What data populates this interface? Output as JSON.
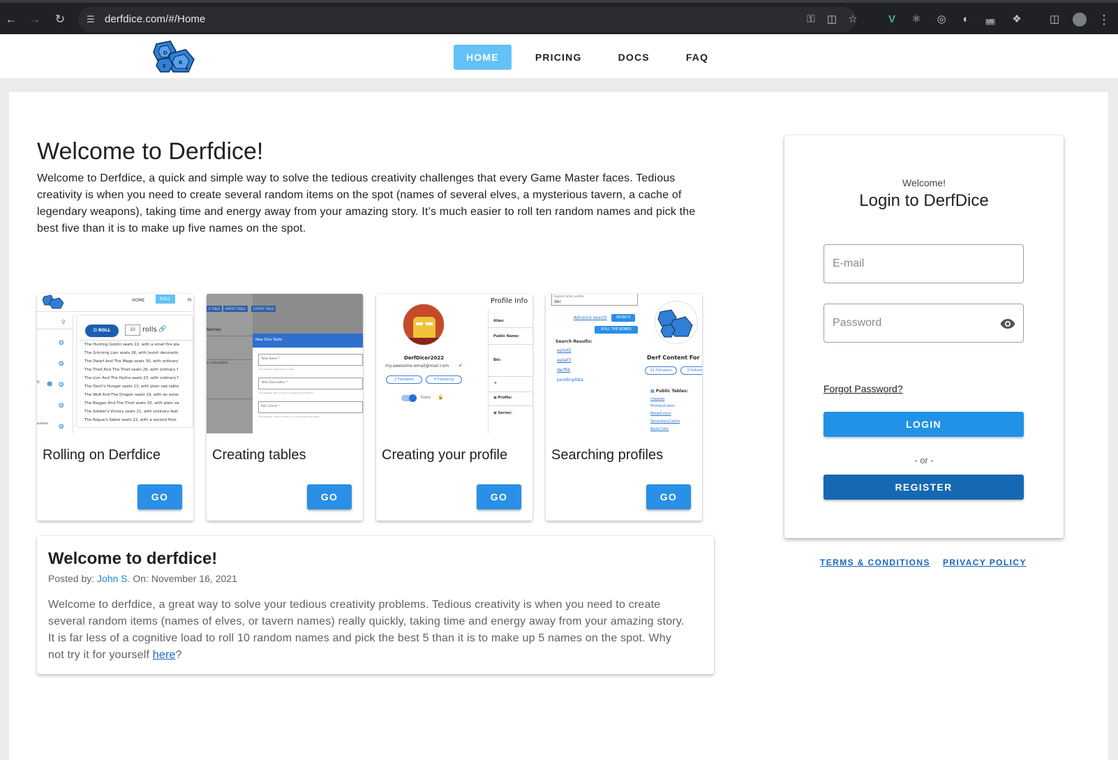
{
  "browser": {
    "url": "derfdice.com/#/Home",
    "ext_badge": "US"
  },
  "nav": {
    "items": [
      {
        "label": "HOME",
        "active": true
      },
      {
        "label": "PRICING"
      },
      {
        "label": "DOCS"
      },
      {
        "label": "FAQ"
      }
    ]
  },
  "intro": {
    "title": "Welcome to Derfdice!",
    "text": "Welcome to Derfdice, a quick and simple way to solve the tedious creativity challenges that every Game Master faces. Tedious creativity is when you need to create several random items on the spot (names of several elves, a mysterious tavern, a cache of legendary weapons), taking time and energy away from your amazing story. It’s much easier to roll ten random names and pick the best five than it is to make up five names on the spot."
  },
  "tiles": [
    {
      "title": "Rolling on Derfdice",
      "button": "GO"
    },
    {
      "title": "Creating tables",
      "button": "GO"
    },
    {
      "title": "Creating your profile",
      "button": "GO"
    },
    {
      "title": "Searching profiles",
      "button": "GO"
    }
  ],
  "tile_previews": {
    "rolling": {
      "nav": [
        "HOME",
        "ROLL",
        "PI"
      ],
      "roll_btn": "ROLL",
      "roll_count": "10",
      "rolls_label": "rolls",
      "results": [
        "The Hunting Goblin seats 22, with a small fire pla",
        "The Grinning Lion seats 26, with lavish decoratio",
        "The Dwarf And The Mage seats 30, with ordinary",
        "The Thief And The Thief seats 26, with ordinary f",
        "The Lion And The Hydra seats 23, with ordinary f",
        "The Devil's Hunger seats 13, with plain oak table",
        "The Wolf And The Dragon seats 19, with an exter",
        "The Beggar And The Thief seats 32, with plain oa",
        "The Soldier's Victory seats 21, with ordinary feat",
        "The Rogue's Sabre seats 22, with a second floor"
      ],
      "side_label": "ourdans"
    },
    "tables": {
      "tabs": [
        "E TABLE",
        "IMPORT TABLE",
        "EXPORT TABLE"
      ],
      "names_label": "Names",
      "dialog_title": "New Dice Table",
      "fields": [
        "Table Name *",
        "Table Description *",
        "Roll Criteria *"
      ],
      "hints": [
        "For example, professions or skills",
        "For example: This is a list of professions for D&D 5e",
        "For example: a 1d6 or 1d10 a. You can always edit it later."
      ],
      "left_hint": "is a description"
    },
    "profile": {
      "heading": "Profile Info",
      "username": "DerfDicer2022",
      "email": "my.awesome.email@mail.com",
      "followers": "2 Followers",
      "following": "4 Following",
      "public_label": "Public",
      "fields": [
        "Alias:",
        "Public Name:",
        "Bio:",
        "Profile:",
        "Server:"
      ]
    },
    "search": {
      "explore_label": "Explore other profiles",
      "query": "der",
      "advance_label": "Advance search",
      "search_btn": "SEARCH",
      "roll_btn": "ROLL THE BONES",
      "results_label": "Search Results:",
      "results": [
        "eplief2",
        "eplief3",
        "derflib",
        "pendingdata"
      ],
      "content_label": "Derf Content For U",
      "followers": "32 Followers",
      "following": "3 Followi",
      "public_tables_label": "Public Tables:",
      "tables": [
        "cheeses",
        "PrimaryColors",
        "MetalColors",
        "SecondaryColors",
        "BasicColor"
      ]
    }
  },
  "post": {
    "title_prefix": "Welcome to ",
    "title_bold": "derfdice",
    "title_suffix": "!",
    "posted_by_label": "Posted by:",
    "author": "John S.",
    "on_label": "On:",
    "date": "November 16, 2021",
    "body": "Welcome to derfdice, a great way to solve your tedious creativity problems. Tedious creativity is when you need to create several random items (names of elves, or tavern names) really quickly, taking time and energy away from your amazing story. It is far less of a cognitive load to roll 10 random names and pick the best 5 than it is to make up 5 names on the spot. Why not try it for yourself ",
    "link_text": "here",
    "body_end": "?"
  },
  "login": {
    "welcome": "Welcome!",
    "title": "Login to DerfDice",
    "email_placeholder": "E-mail",
    "password_placeholder": "Password",
    "forgot": "Forgot Password?",
    "login_btn": "LOGIN",
    "or": "- or -",
    "register_btn": "REGISTER"
  },
  "footer": {
    "terms": "TERMS & CONDITIONS",
    "privacy": "PRIVACY POLICY"
  },
  "colors": {
    "nav_active": "#63c2f5",
    "primary_button": "#2192e6",
    "register_button": "#1668b3",
    "link": "#1565c0",
    "logo_blue": "#2f7fd6"
  }
}
